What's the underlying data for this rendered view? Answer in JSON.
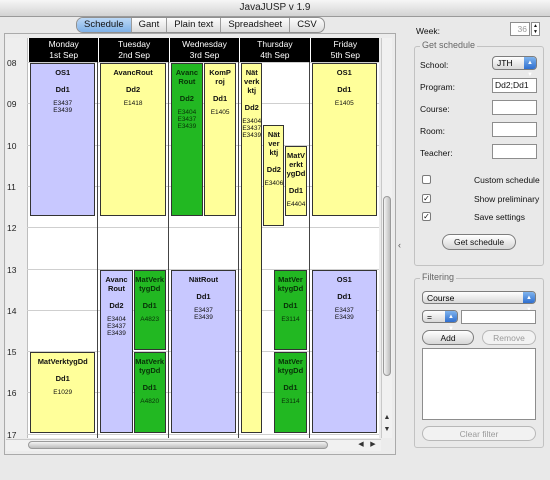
{
  "window": {
    "title": "JavaJUSP v 1.9"
  },
  "tabs": [
    {
      "label": "Schedule",
      "active": true
    },
    {
      "label": "Gant",
      "active": false
    },
    {
      "label": "Plain text",
      "active": false
    },
    {
      "label": "Spreadsheet",
      "active": false
    },
    {
      "label": "CSV",
      "active": false
    }
  ],
  "schedule": {
    "hours": [
      "08",
      "09",
      "10",
      "11",
      "12",
      "13",
      "14",
      "15",
      "16",
      "17"
    ],
    "days": [
      {
        "name": "Monday",
        "date": "1st Sep"
      },
      {
        "name": "Tuesday",
        "date": "2nd Sep"
      },
      {
        "name": "Wednesday",
        "date": "3rd Sep"
      },
      {
        "name": "Thursday",
        "date": "4th Sep"
      },
      {
        "name": "Friday",
        "date": "5th Sep"
      }
    ],
    "colors": {
      "blue": "#c8c8ff",
      "yellow": "#ffff9a",
      "green": "#22b822"
    },
    "events": [
      {
        "day": 0,
        "start": 8.0,
        "end": 11.75,
        "col": 0,
        "cols": 1,
        "color": "blue",
        "title": "OS1",
        "group": "Dd1",
        "rooms": [
          "E3437",
          "E3439"
        ]
      },
      {
        "day": 0,
        "start": 15.0,
        "end": 17.0,
        "col": 0,
        "cols": 1,
        "color": "yellow",
        "title": "MatVerktygDd",
        "group": "Dd1",
        "rooms": [
          "E1029"
        ]
      },
      {
        "day": 1,
        "start": 8.0,
        "end": 11.75,
        "col": 0,
        "cols": 1,
        "color": "yellow",
        "title": "AvancRout",
        "group": "Dd2",
        "rooms": [
          "E1418"
        ]
      },
      {
        "day": 1,
        "start": 13.0,
        "end": 17.0,
        "col": 0,
        "cols": 2,
        "color": "blue",
        "title": "Avanc Rout",
        "group": "Dd2",
        "rooms": [
          "E3404",
          "E3437",
          "E3439"
        ]
      },
      {
        "day": 1,
        "start": 13.0,
        "end": 15.0,
        "col": 1,
        "cols": 2,
        "color": "green",
        "title": "MatVerk tygDd",
        "group": "Dd1",
        "rooms": [
          "A4823"
        ]
      },
      {
        "day": 1,
        "start": 15.0,
        "end": 17.0,
        "col": 1,
        "cols": 2,
        "color": "green",
        "title": "MatVerk tygDd",
        "group": "Dd1",
        "rooms": [
          "A4820"
        ]
      },
      {
        "day": 2,
        "start": 8.0,
        "end": 11.75,
        "col": 0,
        "cols": 2,
        "color": "green",
        "title": "Avanc Rout",
        "group": "Dd2",
        "rooms": [
          "E3404",
          "E3437",
          "E3439"
        ]
      },
      {
        "day": 2,
        "start": 8.0,
        "end": 11.75,
        "col": 1,
        "cols": 2,
        "color": "yellow",
        "title": "KomP roj",
        "group": "Dd1",
        "rooms": [
          "E1405"
        ]
      },
      {
        "day": 2,
        "start": 13.0,
        "end": 17.0,
        "col": 0,
        "cols": 1,
        "color": "blue",
        "title": "NätRout",
        "group": "Dd1",
        "rooms": [
          "E3437",
          "E3439"
        ]
      },
      {
        "day": 3,
        "start": 8.0,
        "end": 17.0,
        "col": 0,
        "cols": 3,
        "color": "yellow",
        "title": "Nät verk ktj",
        "group": "Dd2",
        "rooms": [
          "E3404",
          "E3437",
          "E3439"
        ]
      },
      {
        "day": 3,
        "start": 9.5,
        "end": 12.0,
        "col": 1,
        "cols": 3,
        "color": "yellow",
        "title": "Nät ver ktj",
        "group": "Dd2",
        "rooms": [
          "E3406"
        ]
      },
      {
        "day": 3,
        "start": 10.0,
        "end": 11.75,
        "col": 2,
        "cols": 3,
        "color": "yellow",
        "title": "MatV erkt ygDd",
        "group": "Dd1",
        "rooms": [
          "E4404"
        ]
      },
      {
        "day": 3,
        "start": 13.0,
        "end": 15.0,
        "col": 1,
        "cols": 2,
        "color": "green",
        "title": "MatVer ktygDd",
        "group": "Dd1",
        "rooms": [
          "E3114"
        ]
      },
      {
        "day": 3,
        "start": 15.0,
        "end": 17.0,
        "col": 1,
        "cols": 2,
        "color": "green",
        "title": "MatVer ktygDd",
        "group": "Dd1",
        "rooms": [
          "E3114"
        ]
      },
      {
        "day": 4,
        "start": 8.0,
        "end": 11.75,
        "col": 0,
        "cols": 1,
        "color": "yellow",
        "title": "OS1",
        "group": "Dd1",
        "rooms": [
          "E1405"
        ]
      },
      {
        "day": 4,
        "start": 13.0,
        "end": 17.0,
        "col": 0,
        "cols": 1,
        "color": "blue",
        "title": "OS1",
        "group": "Dd1",
        "rooms": [
          "E3437",
          "E3439"
        ]
      }
    ]
  },
  "sidebar": {
    "week_label": "Week:",
    "week_value": "36",
    "get_schedule": {
      "title": "Get schedule",
      "school_label": "School:",
      "school_value": "JTH",
      "program_label": "Program:",
      "program_value": "Dd2;Dd1",
      "course_label": "Course:",
      "course_value": "",
      "room_label": "Room:",
      "room_value": "",
      "teacher_label": "Teacher:",
      "teacher_value": "",
      "custom_schedule_label": "Custom schedule",
      "show_preliminary_label": "Show preliminary",
      "save_settings_label": "Save settings",
      "button_label": "Get schedule"
    },
    "filtering": {
      "title": "Filtering",
      "field_value": "Course",
      "operator_value": "=",
      "text_value": "",
      "add_label": "Add",
      "remove_label": "Remove",
      "clear_label": "Clear filter"
    }
  }
}
